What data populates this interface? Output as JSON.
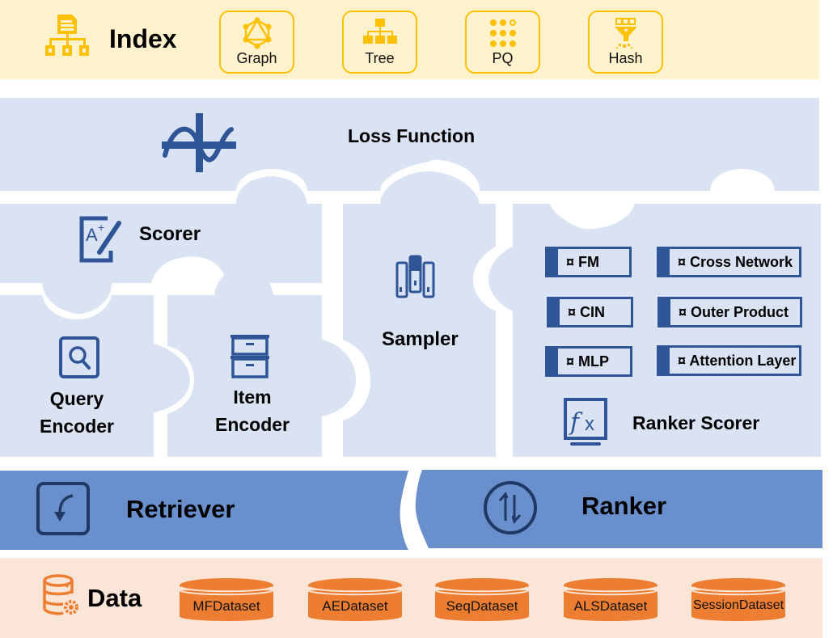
{
  "index": {
    "title": "Index",
    "icon": "hierarchy-document-icon",
    "methods": [
      {
        "label": "Graph",
        "icon": "graph-network-icon"
      },
      {
        "label": "Tree",
        "icon": "tree-hierarchy-icon"
      },
      {
        "label": "PQ",
        "icon": "dot-grid-icon"
      },
      {
        "label": "Hash",
        "icon": "funnel-hash-icon"
      }
    ]
  },
  "loss_function": {
    "label": "Loss Function",
    "icon": "sine-axis-icon"
  },
  "scorer": {
    "label": "Scorer",
    "icon": "grade-pencil-icon"
  },
  "query_encoder": {
    "line1": "Query",
    "line2": "Encoder",
    "icon": "search-box-icon"
  },
  "item_encoder": {
    "line1": "Item",
    "line2": "Encoder",
    "icon": "drawers-icon"
  },
  "sampler": {
    "label": "Sampler",
    "icon": "sample-tubes-icon"
  },
  "ranker_scorer": {
    "label": "Ranker Scorer",
    "icon": "fx-monitor-icon",
    "components": [
      {
        "label": "¤ FM"
      },
      {
        "label": "¤ Cross Network"
      },
      {
        "label": "¤ CIN"
      },
      {
        "label": "¤ Outer Product"
      },
      {
        "label": "¤ MLP"
      },
      {
        "label": "¤ Attention Layer"
      }
    ]
  },
  "retriever": {
    "label": "Retriever",
    "icon": "curved-arrow-box-icon"
  },
  "ranker": {
    "label": "Ranker",
    "icon": "up-down-arrows-circle-icon"
  },
  "data": {
    "title": "Data",
    "icon": "database-gear-icon",
    "datasets": [
      {
        "label": "MFDataset"
      },
      {
        "label": "AEDataset"
      },
      {
        "label": "SeqDataset"
      },
      {
        "label": "ALSDataset"
      },
      {
        "label": "SessionDataset"
      }
    ]
  },
  "colors": {
    "index_bg": "#fff2cc",
    "index_accent": "#ffc000",
    "module_bg": "#dae3f3",
    "module_accent": "#2f5597",
    "stage_bg": "#6a8fcd",
    "data_bg": "#fbe5d6",
    "data_accent": "#ed7d31"
  }
}
